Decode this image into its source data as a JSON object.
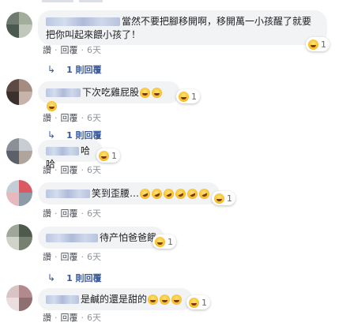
{
  "actions": {
    "like": "讚",
    "reply": "回覆",
    "separator": "·"
  },
  "comments": [
    {
      "text_line1": "當然不要把腳移開啊，移開萬一小孩醒了就要",
      "text_line2": "把你叫起來餵小孩了！",
      "reaction_count": "1",
      "time": "6天",
      "replies_label": "1 則回覆",
      "avatar_colors": [
        "#6f7a70",
        "#a3ad9c",
        "#4b5a50",
        "#c2c7bb"
      ]
    },
    {
      "text": "下次吃雞屁股",
      "reaction_count": "1",
      "time": "6天",
      "replies_label": "1 則回覆",
      "avatar_colors": [
        "#5e4a44",
        "#a58b80",
        "#3a302e",
        "#c6b4aa"
      ]
    },
    {
      "text": "哈哈",
      "reaction_count": "1",
      "time": "6天",
      "avatar_colors": [
        "#8a8f98",
        "#c9ccd2",
        "#5c6068",
        "#b0a59b"
      ]
    },
    {
      "text": "笑到歪腰…",
      "reaction_count": "1",
      "time": "6天",
      "avatar_colors": [
        "#c3cdd6",
        "#d95a63",
        "#e7b8bd",
        "#8d9aa7"
      ]
    },
    {
      "text": "待产怕爸爸餓",
      "reaction_count": "1",
      "time": "6天",
      "avatar_colors": [
        "#9fa69a",
        "#505a4c",
        "#cfd3c9",
        "#77806f"
      ]
    },
    {
      "text": "是鹹的還是甜的",
      "reaction_count": "1",
      "time": "6天",
      "replies_label": "1 則回覆",
      "avatar_colors": [
        "#d8c4c4",
        "#b08a8c",
        "#eadede",
        "#8e6f72"
      ]
    }
  ]
}
